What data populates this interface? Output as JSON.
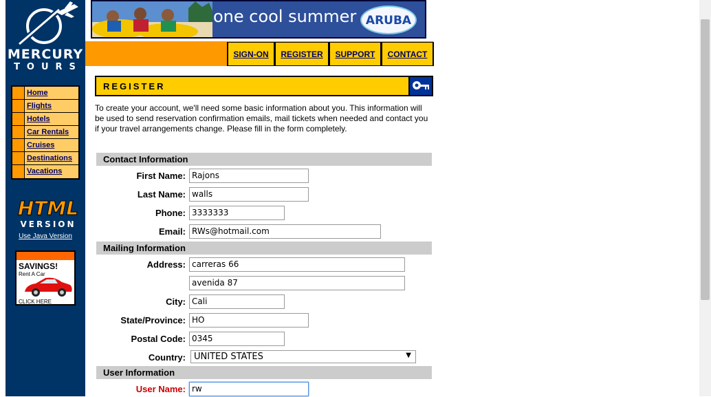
{
  "logo": {
    "line1": "MERCURY",
    "line2": "TOURS"
  },
  "sidebar": {
    "items": [
      {
        "label": "Home"
      },
      {
        "label": "Flights"
      },
      {
        "label": "Hotels"
      },
      {
        "label": "Car Rentals"
      },
      {
        "label": "Cruises"
      },
      {
        "label": "Destinations"
      },
      {
        "label": "Vacations"
      }
    ],
    "java_link": "Use Java Version",
    "ad": {
      "title": "SAVINGS!",
      "sub": "Rent A Car",
      "click": "CLICK HERE"
    }
  },
  "banner": {
    "text": "one cool summer",
    "aruba": "ARUBA"
  },
  "topnav": [
    {
      "label": "SIGN-ON"
    },
    {
      "label": "REGISTER"
    },
    {
      "label": "SUPPORT"
    },
    {
      "label": "CONTACT"
    }
  ],
  "register": {
    "title": "REGISTER",
    "intro": "To create your account, we'll need some basic information about you. This information will be used to send reservation confirmation emails, mail tickets when needed and contact you if your travel arrangements change. Please fill in the form completely."
  },
  "contact_section": {
    "title": "Contact Information",
    "first_name": {
      "label": "First Name:",
      "value": "Rajons"
    },
    "last_name": {
      "label": "Last Name:",
      "value": "walls"
    },
    "phone": {
      "label": "Phone:",
      "value": "3333333"
    },
    "email": {
      "label": "Email:",
      "value": "RWs@hotmail.com"
    }
  },
  "mailing_section": {
    "title": "Mailing Information",
    "address": {
      "label": "Address:",
      "value1": "carreras 66",
      "value2": "avenida 87"
    },
    "city": {
      "label": "City:",
      "value": "Cali"
    },
    "state": {
      "label": "State/Province:",
      "value": "HO"
    },
    "postal": {
      "label": "Postal Code:",
      "value": "0345"
    },
    "country": {
      "label": "Country:",
      "value": "UNITED STATES"
    }
  },
  "user_section": {
    "title": "User Information",
    "user_name": {
      "label": "User Name:",
      "value": "rw"
    }
  },
  "colors": {
    "sidebar_bg": "#003366",
    "accent_orange": "#ff9900",
    "accent_yellow": "#ffcc00",
    "section_gray": "#cccccc",
    "required_red": "#cc0000"
  }
}
